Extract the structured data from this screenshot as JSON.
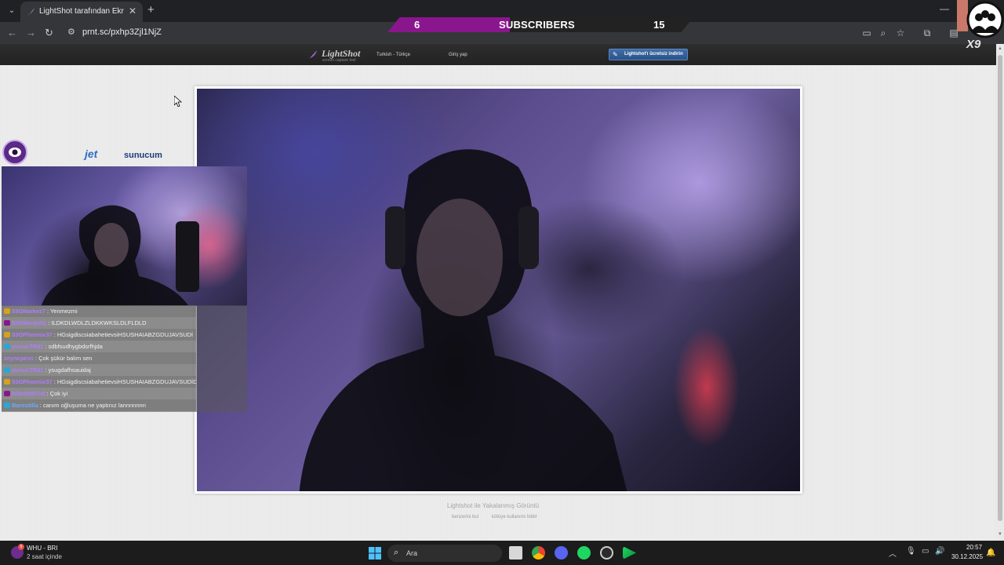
{
  "browser": {
    "tab_title": "LightShot tarafından Ekran Görü",
    "url": "prnt.sc/pxhp3Zjl1NjZ"
  },
  "overlay": {
    "subscribers_current": "6",
    "subscribers_label": "SUBSCRIBERS",
    "subscribers_goal": "15",
    "subscribers_progress": 0.4,
    "sponsor_name_a": "jet",
    "sponsor_name_b": "sunucum",
    "avatar_tag": "X9",
    "accent_color": "#8a168e"
  },
  "lightshot": {
    "logo_text": "LightShot",
    "logo_sub": "screen capture tool",
    "language": "Turkish - Türkçe",
    "login": "Giriş yap",
    "download_button": "Lightshot'ı ücretsiz indirin",
    "caption": "Lightshot ile Yakalanmış Görüntü",
    "similar_link": "benzerini bul",
    "report_link": "kötüye kullanımı bildir"
  },
  "chat": {
    "messages": [
      {
        "user": "53GNarkez7",
        "text": ": Yenmezmi",
        "color": "#b07cff",
        "badge": "#d4a21f"
      },
      {
        "user": "53GManju91",
        "text": ": ILDKDLWDLZLDKKWKSLDLFLDLD",
        "color": "#b07cff",
        "badge": "#8a168e"
      },
      {
        "user": "53GPhoenix37",
        "text": ": HGsigdiscsiabahetievsiHSUSHAIABZGDUJAVSUDİ",
        "color": "#b07cff",
        "badge": "#d4a21f"
      },
      {
        "user": "yunusTR61",
        "text": ": sdbfsudhygbdsrfhjda",
        "color": "#b07cff",
        "badge": "#2aa6d8"
      },
      {
        "user": "zeynepess",
        "text": ": Çok şükür balım sen",
        "color": "#b07cff",
        "badge": ""
      },
      {
        "user": "yunusTR61",
        "text": ": ysugdafhsauidaj",
        "color": "#b07cff",
        "badge": "#2aa6d8"
      },
      {
        "user": "53GPhoenix37",
        "text": ": HGsigdiscsiabahetievsiHSUSHAIABZGDUJAVSUDİD",
        "color": "#b07cff",
        "badge": "#d4a21f"
      },
      {
        "user": "killer0697x8",
        "text": ": Çok iyi",
        "color": "#b07cff",
        "badge": "#8a168e"
      },
      {
        "user": "Barestilla",
        "text": ": canım oğluşuma ne yaptınız lannnnnnn",
        "color": "#6fa8ff",
        "badge": "#2aa6d8"
      }
    ]
  },
  "taskbar": {
    "news_title": "WHU - BRI",
    "news_sub": "2 saat içinde",
    "news_badge": "9",
    "search_placeholder": "Ara",
    "time": "20:57",
    "date": "30.12.2025"
  }
}
